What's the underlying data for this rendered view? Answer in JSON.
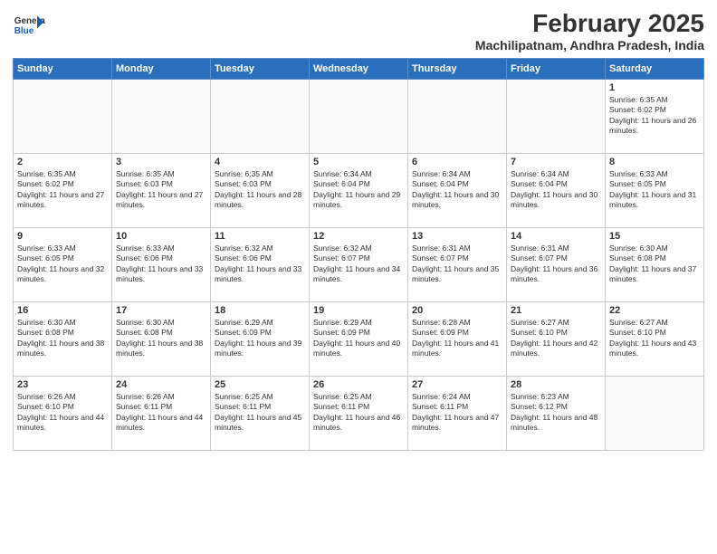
{
  "logo": {
    "general": "General",
    "blue": "Blue"
  },
  "title": "February 2025",
  "subtitle": "Machilipatnam, Andhra Pradesh, India",
  "days_of_week": [
    "Sunday",
    "Monday",
    "Tuesday",
    "Wednesday",
    "Thursday",
    "Friday",
    "Saturday"
  ],
  "weeks": [
    [
      {
        "day": "",
        "info": ""
      },
      {
        "day": "",
        "info": ""
      },
      {
        "day": "",
        "info": ""
      },
      {
        "day": "",
        "info": ""
      },
      {
        "day": "",
        "info": ""
      },
      {
        "day": "",
        "info": ""
      },
      {
        "day": "1",
        "info": "Sunrise: 6:35 AM\nSunset: 6:02 PM\nDaylight: 11 hours and 26 minutes."
      }
    ],
    [
      {
        "day": "2",
        "info": "Sunrise: 6:35 AM\nSunset: 6:02 PM\nDaylight: 11 hours and 27 minutes."
      },
      {
        "day": "3",
        "info": "Sunrise: 6:35 AM\nSunset: 6:03 PM\nDaylight: 11 hours and 27 minutes."
      },
      {
        "day": "4",
        "info": "Sunrise: 6:35 AM\nSunset: 6:03 PM\nDaylight: 11 hours and 28 minutes."
      },
      {
        "day": "5",
        "info": "Sunrise: 6:34 AM\nSunset: 6:04 PM\nDaylight: 11 hours and 29 minutes."
      },
      {
        "day": "6",
        "info": "Sunrise: 6:34 AM\nSunset: 6:04 PM\nDaylight: 11 hours and 30 minutes."
      },
      {
        "day": "7",
        "info": "Sunrise: 6:34 AM\nSunset: 6:04 PM\nDaylight: 11 hours and 30 minutes."
      },
      {
        "day": "8",
        "info": "Sunrise: 6:33 AM\nSunset: 6:05 PM\nDaylight: 11 hours and 31 minutes."
      }
    ],
    [
      {
        "day": "9",
        "info": "Sunrise: 6:33 AM\nSunset: 6:05 PM\nDaylight: 11 hours and 32 minutes."
      },
      {
        "day": "10",
        "info": "Sunrise: 6:33 AM\nSunset: 6:06 PM\nDaylight: 11 hours and 33 minutes."
      },
      {
        "day": "11",
        "info": "Sunrise: 6:32 AM\nSunset: 6:06 PM\nDaylight: 11 hours and 33 minutes."
      },
      {
        "day": "12",
        "info": "Sunrise: 6:32 AM\nSunset: 6:07 PM\nDaylight: 11 hours and 34 minutes."
      },
      {
        "day": "13",
        "info": "Sunrise: 6:31 AM\nSunset: 6:07 PM\nDaylight: 11 hours and 35 minutes."
      },
      {
        "day": "14",
        "info": "Sunrise: 6:31 AM\nSunset: 6:07 PM\nDaylight: 11 hours and 36 minutes."
      },
      {
        "day": "15",
        "info": "Sunrise: 6:30 AM\nSunset: 6:08 PM\nDaylight: 11 hours and 37 minutes."
      }
    ],
    [
      {
        "day": "16",
        "info": "Sunrise: 6:30 AM\nSunset: 6:08 PM\nDaylight: 11 hours and 38 minutes."
      },
      {
        "day": "17",
        "info": "Sunrise: 6:30 AM\nSunset: 6:08 PM\nDaylight: 11 hours and 38 minutes."
      },
      {
        "day": "18",
        "info": "Sunrise: 6:29 AM\nSunset: 6:09 PM\nDaylight: 11 hours and 39 minutes."
      },
      {
        "day": "19",
        "info": "Sunrise: 6:29 AM\nSunset: 6:09 PM\nDaylight: 11 hours and 40 minutes."
      },
      {
        "day": "20",
        "info": "Sunrise: 6:28 AM\nSunset: 6:09 PM\nDaylight: 11 hours and 41 minutes."
      },
      {
        "day": "21",
        "info": "Sunrise: 6:27 AM\nSunset: 6:10 PM\nDaylight: 11 hours and 42 minutes."
      },
      {
        "day": "22",
        "info": "Sunrise: 6:27 AM\nSunset: 6:10 PM\nDaylight: 11 hours and 43 minutes."
      }
    ],
    [
      {
        "day": "23",
        "info": "Sunrise: 6:26 AM\nSunset: 6:10 PM\nDaylight: 11 hours and 44 minutes."
      },
      {
        "day": "24",
        "info": "Sunrise: 6:26 AM\nSunset: 6:11 PM\nDaylight: 11 hours and 44 minutes."
      },
      {
        "day": "25",
        "info": "Sunrise: 6:25 AM\nSunset: 6:11 PM\nDaylight: 11 hours and 45 minutes."
      },
      {
        "day": "26",
        "info": "Sunrise: 6:25 AM\nSunset: 6:11 PM\nDaylight: 11 hours and 46 minutes."
      },
      {
        "day": "27",
        "info": "Sunrise: 6:24 AM\nSunset: 6:11 PM\nDaylight: 11 hours and 47 minutes."
      },
      {
        "day": "28",
        "info": "Sunrise: 6:23 AM\nSunset: 6:12 PM\nDaylight: 11 hours and 48 minutes."
      },
      {
        "day": "",
        "info": ""
      }
    ]
  ]
}
